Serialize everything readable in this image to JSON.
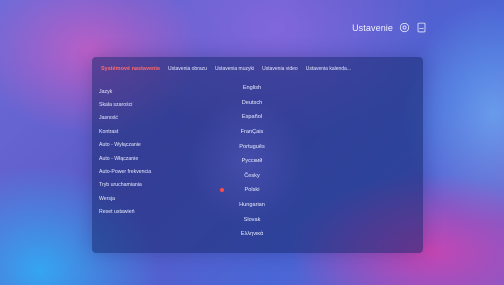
{
  "header": {
    "title": "Ustavenie",
    "icons": [
      "settings-icon",
      "storage-icon"
    ]
  },
  "tabs": [
    {
      "label": "Systémové nastavenie",
      "active": true
    },
    {
      "label": "Ustavenia obrazu",
      "active": false
    },
    {
      "label": "Ustavenia muzyki",
      "active": false
    },
    {
      "label": "Ustavenia video",
      "active": false
    },
    {
      "label": "Ustavenia kalenda...",
      "active": false
    }
  ],
  "sidebar": {
    "items": [
      {
        "label": "Jazyk"
      },
      {
        "label": "Skala szarości"
      },
      {
        "label": "Jasność"
      },
      {
        "label": "Kontrast"
      },
      {
        "label": "Auto - Wyłączanie"
      },
      {
        "label": "Auto - Włączanie"
      },
      {
        "label": "Auto-Power frekvencia"
      },
      {
        "label": "Tryb uruchamiania"
      },
      {
        "label": "Wersja"
      },
      {
        "label": "Reset ustawień"
      }
    ]
  },
  "languages": {
    "selected": "Polski",
    "items": [
      {
        "label": "English"
      },
      {
        "label": "Deutsch"
      },
      {
        "label": "Español"
      },
      {
        "label": "FranÇais"
      },
      {
        "label": "Português"
      },
      {
        "label": "Pyccкий"
      },
      {
        "label": "Česky"
      },
      {
        "label": "Polski"
      },
      {
        "label": "Hungarian"
      },
      {
        "label": "Slovak"
      },
      {
        "label": "Ελληνικά"
      }
    ]
  },
  "colors": {
    "accent": "#ff4a4a",
    "panel": "#16266c",
    "text": "#e6eaff"
  }
}
